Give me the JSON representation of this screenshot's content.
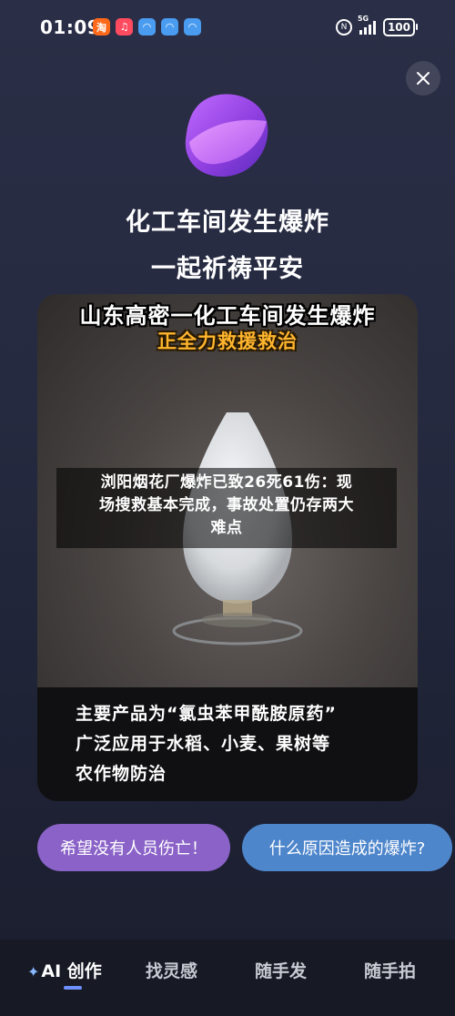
{
  "status_bar": {
    "time": "01:09",
    "network": "5G",
    "battery": "100",
    "app_icons": [
      {
        "name": "taobao-icon",
        "glyph": "淘",
        "color": "#ff6a1a"
      },
      {
        "name": "music-icon",
        "glyph": "♫",
        "color": "#ff4b5f"
      },
      {
        "name": "app-icon-1",
        "glyph": "◠",
        "color": "#4a9cf0"
      },
      {
        "name": "app-icon-2",
        "glyph": "◠",
        "color": "#4a9cf0"
      },
      {
        "name": "app-icon-3",
        "glyph": "◠",
        "color": "#4a9cf0"
      }
    ]
  },
  "header": {
    "headline_1": "化工车间发生爆炸",
    "headline_2": "一起祈祷平安"
  },
  "card": {
    "title": "山东高密一化工车间发生爆炸",
    "subtitle": "正全力救援救治",
    "caption_lines": [
      "主要产品为“氯虫苯甲酰胺原药”",
      "广泛应用于水稻、小麦、果树等",
      "农作物防治"
    ]
  },
  "news_overlay": {
    "line_1": "浏阳烟花厂爆炸已致26死61伤：现",
    "line_2": "场搜救基本完成，事故处置仍存两大",
    "line_3": "难点"
  },
  "suggestions": {
    "left": "希望没有人员伤亡！",
    "right": "什么原因造成的爆炸?"
  },
  "bottom_nav": {
    "items": [
      "AI 创作",
      "找灵感",
      "随手发",
      "随手拍"
    ],
    "active_index": 0,
    "accent": "#6e8fff"
  }
}
